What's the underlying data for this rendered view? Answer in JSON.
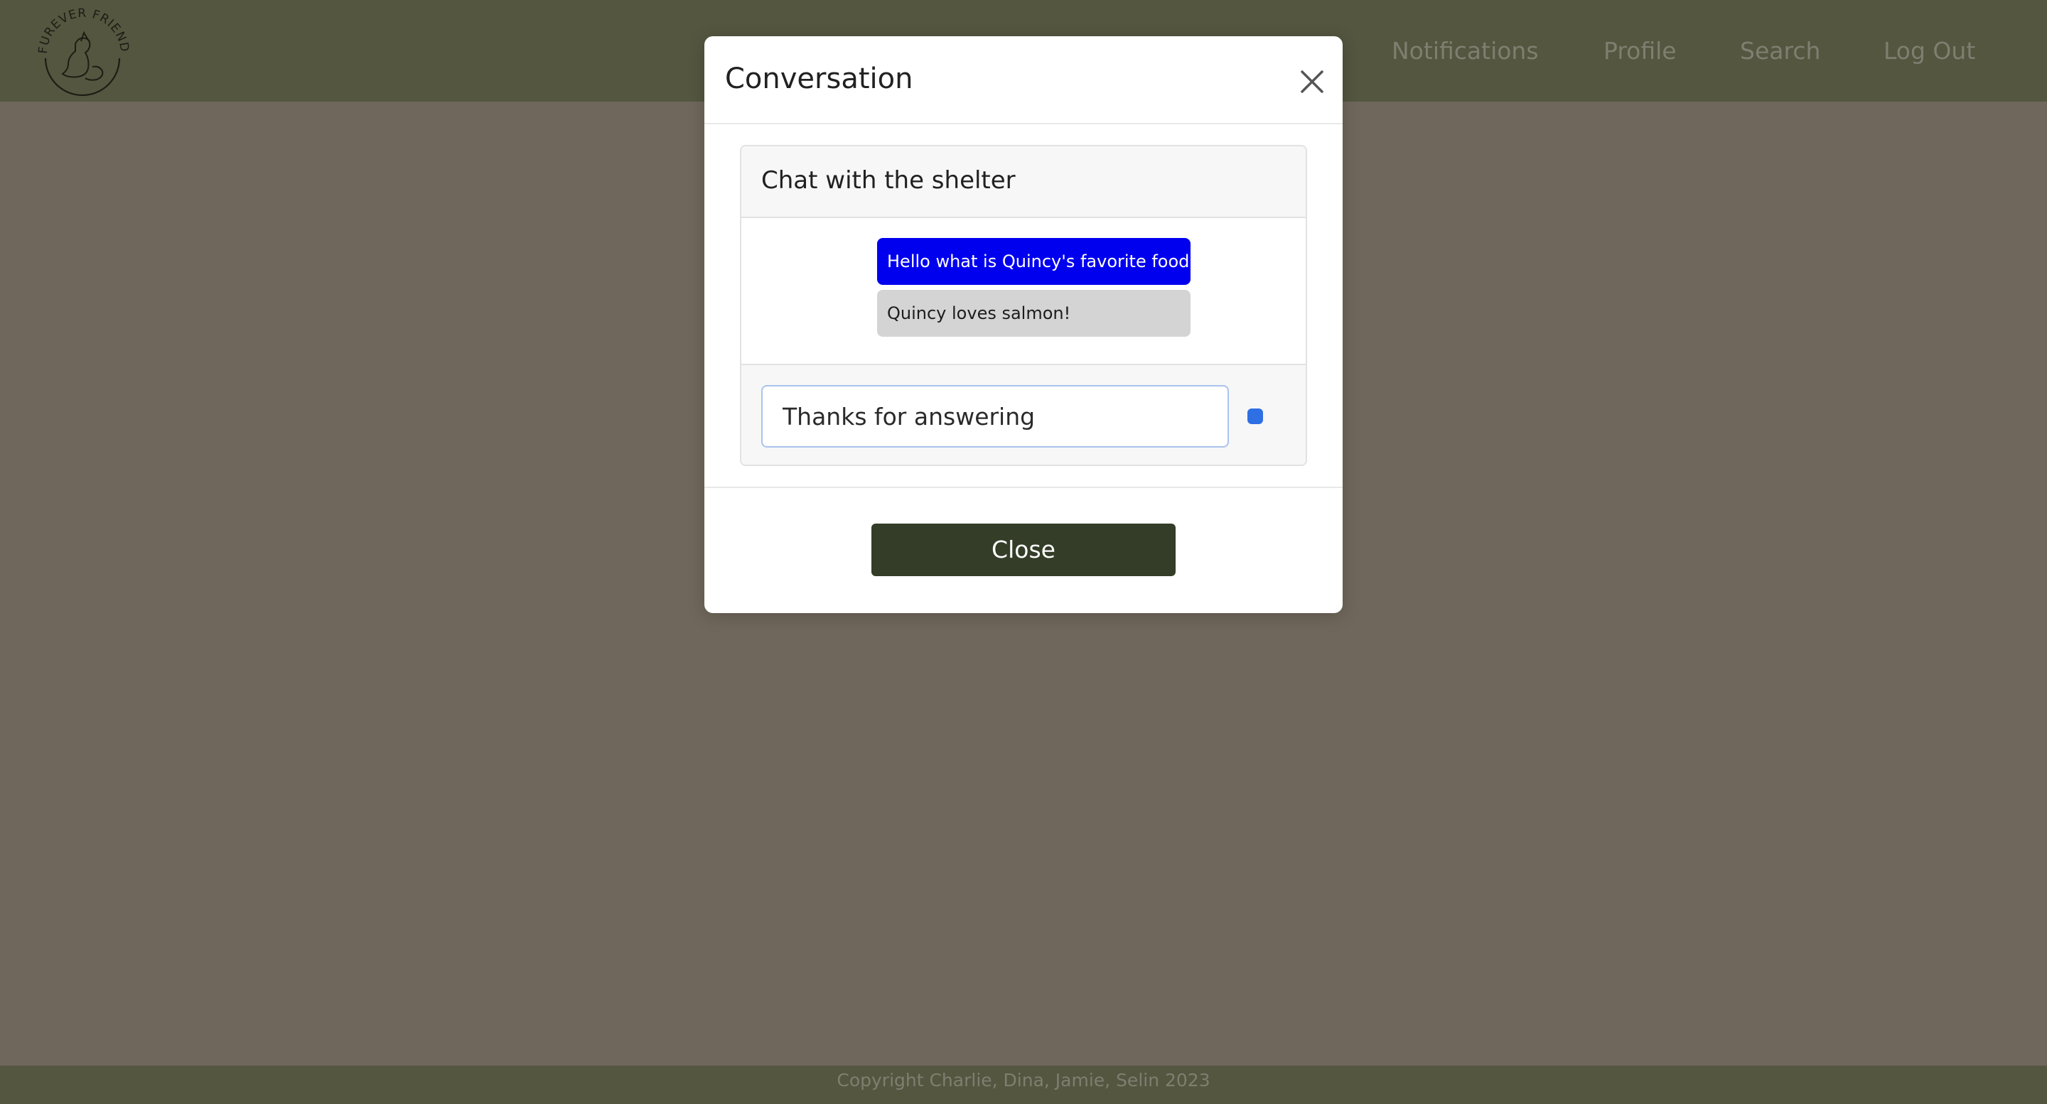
{
  "navbar": {
    "logo_icon": "furever-friends-logo-icon",
    "logo_text": "FUREVER FRIENDS",
    "links": {
      "notifications": "Notifications",
      "profile": "Profile",
      "search": "Search",
      "logout": "Log Out"
    }
  },
  "modal": {
    "title": "Conversation",
    "close_icon": "close-icon",
    "chat": {
      "header": "Chat with the shelter",
      "messages": [
        {
          "sender": "user",
          "text": "Hello what is Quincy's favorite food?"
        },
        {
          "sender": "shelter",
          "text": "Quincy loves salmon!"
        }
      ],
      "input_value": "Thanks for answering",
      "send_icon": "send-dot-icon"
    },
    "close_label": "Close"
  },
  "footer": {
    "copyright": "Copyright Charlie, Dina, Jamie, Selin 2023"
  },
  "colors": {
    "navbar": "#545640",
    "overlay_bg": "#6f675b",
    "sent_bubble": "#0000ee",
    "received_bubble": "#d4d4d4",
    "close_button": "#343d27",
    "send_dot": "#2f6fe4"
  }
}
